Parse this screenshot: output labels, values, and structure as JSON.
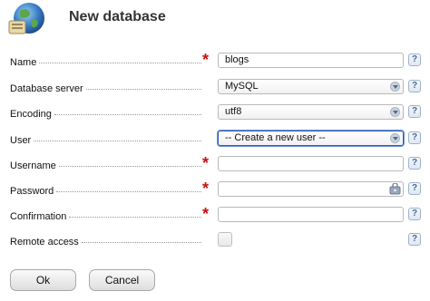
{
  "dialog": {
    "title": "New database",
    "icon": "database-globe-icon"
  },
  "form": {
    "name": {
      "label": "Name",
      "value": "blogs",
      "required": true
    },
    "database_server": {
      "label": "Database server",
      "value": "MySQL"
    },
    "encoding": {
      "label": "Encoding",
      "value": "utf8"
    },
    "user": {
      "label": "User",
      "value": "-- Create a new user --"
    },
    "username": {
      "label": "Username",
      "value": "",
      "required": true
    },
    "password": {
      "label": "Password",
      "value": "",
      "required": true
    },
    "confirmation": {
      "label": "Confirmation",
      "value": "",
      "required": true
    },
    "remote_access": {
      "label": "Remote access",
      "checked": false
    }
  },
  "required_marker": "*",
  "help_glyph": "?",
  "buttons": {
    "ok": "Ok",
    "cancel": "Cancel"
  },
  "colors": {
    "required": "#cc1111",
    "focus": "#2a5db0"
  }
}
